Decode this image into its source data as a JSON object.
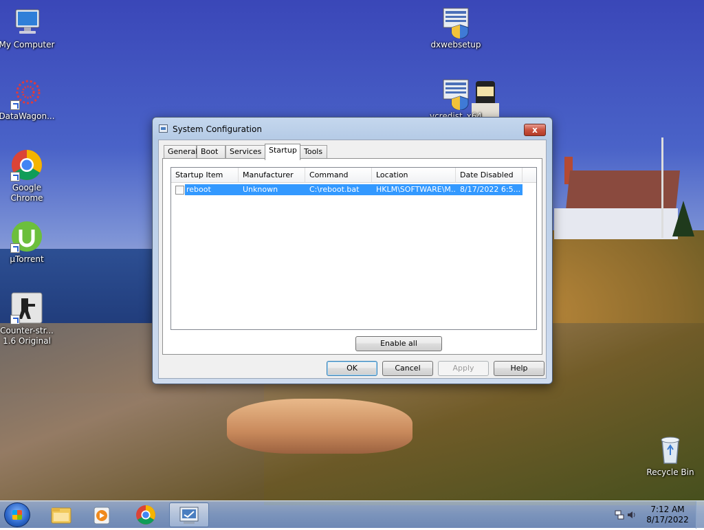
{
  "desktop": {
    "icons": [
      {
        "label": "My Computer"
      },
      {
        "label": "DataWagon..."
      },
      {
        "label": "Google Chrome"
      },
      {
        "label": "µTorrent"
      },
      {
        "label": "Counter-str... 1.6 Original"
      },
      {
        "label": "dxwebsetup"
      },
      {
        "label": "vcredist_x64"
      },
      {
        "label": "Recycle Bin"
      }
    ]
  },
  "dialog": {
    "title": "System Configuration",
    "close_label": "x",
    "tabs": [
      {
        "label": "General"
      },
      {
        "label": "Boot"
      },
      {
        "label": "Services"
      },
      {
        "label": "Startup"
      },
      {
        "label": "Tools"
      }
    ],
    "active_tab": "Startup",
    "startup_list": {
      "columns": [
        "Startup Item",
        "Manufacturer",
        "Command",
        "Location",
        "Date Disabled"
      ],
      "rows": [
        {
          "checked": false,
          "startup_item": "reboot",
          "manufacturer": "Unknown",
          "command": "C:\\reboot.bat",
          "location": "HKLM\\SOFTWARE\\M...",
          "date_disabled": "8/17/2022 6:5..."
        }
      ]
    },
    "enable_all_label": "Enable all",
    "buttons": {
      "ok": "OK",
      "cancel": "Cancel",
      "apply": "Apply",
      "help": "Help"
    }
  },
  "taskbar": {
    "pinned": [
      {
        "icon": "windows-explorer-icon"
      },
      {
        "icon": "media-player-icon"
      },
      {
        "icon": "chrome-icon"
      },
      {
        "icon": "system-configuration-icon"
      }
    ],
    "clock": {
      "time": "7:12 AM",
      "date": "8/17/2022"
    }
  },
  "colors": {
    "selection": "#3399ff",
    "close_button": "#c9523e",
    "desktop_sky": "#3a47b8"
  }
}
